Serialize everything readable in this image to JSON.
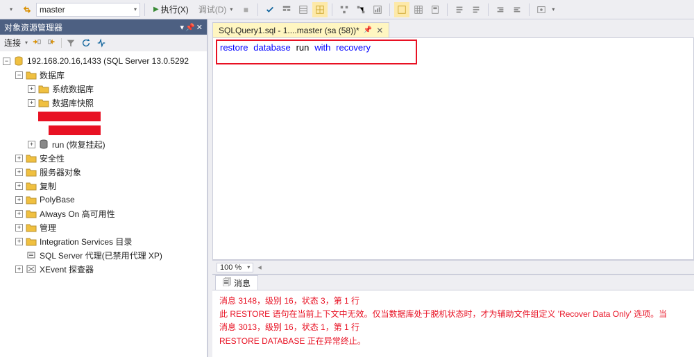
{
  "toolbar": {
    "database_combo": "master",
    "execute_label": "执行(X)",
    "debug_label": "调试(D)"
  },
  "object_explorer": {
    "title": "对象资源管理器",
    "connect_label": "连接",
    "root": "192.168.20.16,1433 (SQL Server 13.0.5292",
    "nodes": {
      "databases": "数据库",
      "system_db": "系统数据库",
      "db_snapshot": "数据库快照",
      "run_db": "run (恢复挂起)",
      "security": "安全性",
      "server_objects": "服务器对象",
      "replication": "复制",
      "polybase": "PolyBase",
      "alwayson": "Always On 高可用性",
      "management": "管理",
      "isc": "Integration Services 目录",
      "agent": "SQL Server 代理(已禁用代理 XP)",
      "xevent": "XEvent 探查器"
    }
  },
  "tab": {
    "title": "SQLQuery1.sql - 1....master (sa (58))*"
  },
  "code": {
    "kw1": "restore",
    "kw2": "database",
    "id": "run",
    "kw3": "with",
    "kw4": "recovery"
  },
  "zoom": {
    "value": "100 %"
  },
  "messages": {
    "tab_label": "消息",
    "line1": "消息 3148，级别 16，状态 3，第 1 行",
    "line2": "此 RESTORE 语句在当前上下文中无效。仅当数据库处于脱机状态时，才为辅助文件组定义 'Recover Data Only' 选项。当",
    "line3": "消息 3013，级别 16，状态 1，第 1 行",
    "line4": "RESTORE DATABASE 正在异常终止。"
  }
}
